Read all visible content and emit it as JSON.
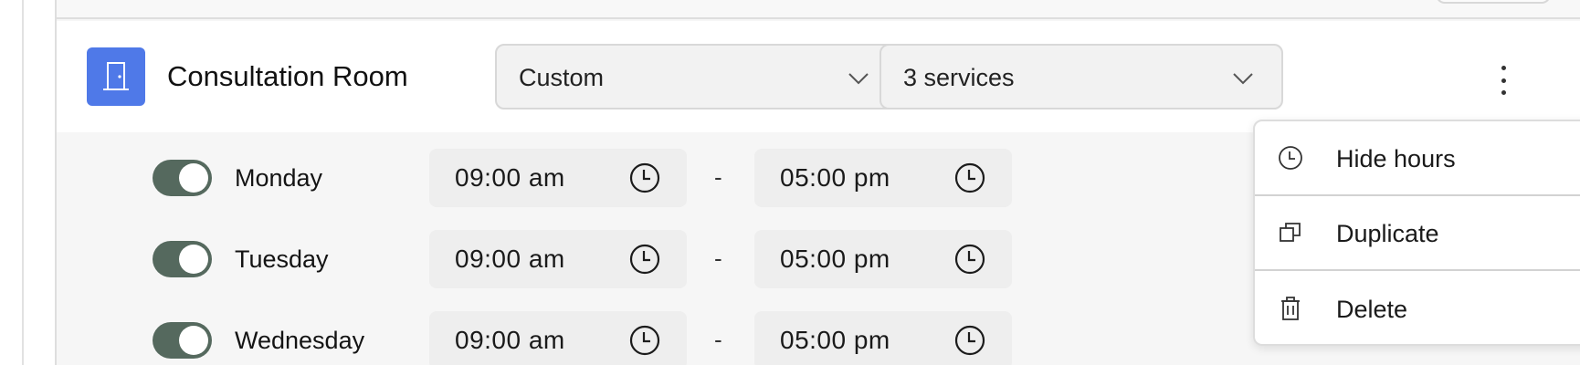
{
  "room": {
    "name": "Consultation Room",
    "icon": "door-icon",
    "icon_color": "#4f79e8"
  },
  "schedule_select": {
    "value": "Custom"
  },
  "services_select": {
    "value": "3 services"
  },
  "days": [
    {
      "name": "Monday",
      "enabled": true,
      "start": "09:00 am",
      "end": "05:00 pm"
    },
    {
      "name": "Tuesday",
      "enabled": true,
      "start": "09:00 am",
      "end": "05:00 pm"
    },
    {
      "name": "Wednesday",
      "enabled": true,
      "start": "09:00 am",
      "end": "05:00 pm"
    }
  ],
  "time_separator": "-",
  "menu": {
    "items": [
      {
        "label": "Hide hours",
        "icon": "clock-icon"
      },
      {
        "label": "Duplicate",
        "icon": "duplicate-icon"
      },
      {
        "label": "Delete",
        "icon": "trash-icon"
      }
    ]
  },
  "colors": {
    "toggle_on": "#55695e",
    "accent": "#4f79e8"
  }
}
